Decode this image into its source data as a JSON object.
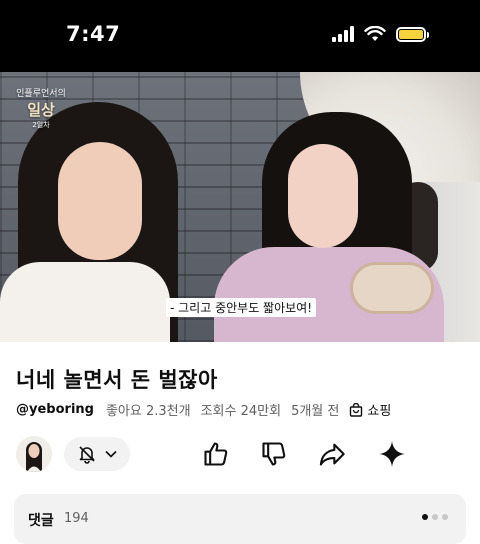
{
  "status_bar": {
    "time": "7:47",
    "battery_color": "#f5d33b"
  },
  "video": {
    "channel_logo": {
      "line1": "인플루언서의",
      "line2": "일상",
      "line3": "2일차"
    },
    "subtitle": "- 그리고 중안부도 짧아보여!"
  },
  "details": {
    "title": "너네 놀면서 돈 벌잖아",
    "channel_handle": "@yeboring",
    "likes": "좋아요 2.3천개",
    "views": "조회수 24만회",
    "age": "5개월 전",
    "shopping_label": "쇼핑"
  },
  "actions": {
    "icons": [
      "bell-icon",
      "chevron-down-icon",
      "thumbs-up-icon",
      "thumbs-down-icon",
      "share-icon",
      "sparkle-icon"
    ]
  },
  "comments": {
    "label": "댓글",
    "count": "194"
  }
}
